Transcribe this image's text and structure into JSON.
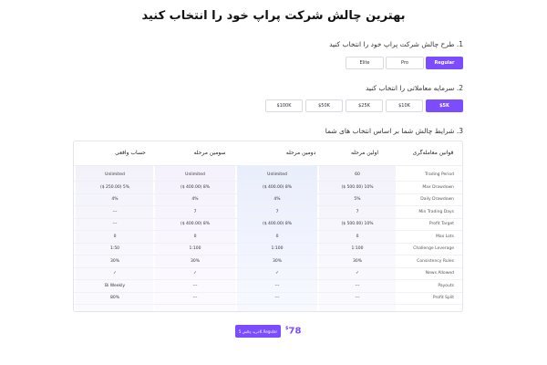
{
  "title": "بهترین چالش شرکت پراپ خود را انتخاب کنید",
  "step1": {
    "label": "1. طرح چالش شرکت پراپ خود را انتخاب کنید",
    "options": [
      "Elite",
      "Pro",
      "Regular"
    ],
    "selected": "Regular"
  },
  "step2": {
    "label": "2. سرمایه معاملاتی را انتخاب کنید",
    "options": [
      "$100K",
      "$50K",
      "$25K",
      "$10K",
      "$5K"
    ],
    "selected": "$5K"
  },
  "step3": {
    "label": "3. شرایط چالش شما بر اساس انتخاب های شما"
  },
  "table": {
    "headers": [
      "قوانین معامله‌گری",
      "اولین مرحله",
      "دومین مرحله",
      "سومین مرحله",
      "حساب واقعی"
    ],
    "rows": [
      {
        "label": "Trading Period",
        "c1": "60",
        "c2": "Unlimited",
        "c3": "Unlimited",
        "c4": "Unlimited"
      },
      {
        "label": "Max Drawdown",
        "c1": "($ 500.00) 10%",
        "c2": "($ 400.00) 8%",
        "c3": "($ 400.00) 8%",
        "c4": "($ 250.00) 5%"
      },
      {
        "label": "Daily Drawdown",
        "c1": "5%",
        "c2": "4%",
        "c3": "4%",
        "c4": "4%"
      },
      {
        "label": "Min Trading Days",
        "c1": "7",
        "c2": "7",
        "c3": "7",
        "c4": "---"
      },
      {
        "label": "Profit Target",
        "c1": "($ 500.00) 10%",
        "c2": "($ 400.00) 8%",
        "c3": "($ 400.00) 8%",
        "c4": "---"
      },
      {
        "label": "Max Lots",
        "c1": "0",
        "c2": "0",
        "c3": "0",
        "c4": "0"
      },
      {
        "label": "Challenge Leverage",
        "c1": "1:100",
        "c2": "1:100",
        "c3": "1:100",
        "c4": "1:50"
      },
      {
        "label": "Consistency Rules",
        "c1": "30%",
        "c2": "30%",
        "c3": "30%",
        "c4": "30%"
      },
      {
        "label": "News Allowed",
        "c1": "✓",
        "c2": "✓",
        "c3": "✓",
        "c4": "✓"
      },
      {
        "label": "Payouts",
        "c1": "---",
        "c2": "---",
        "c3": "---",
        "c4": "Bi Weekly"
      },
      {
        "label": "Profit Split",
        "c1": "---",
        "c2": "---",
        "c3": "---",
        "c4": "80%"
      }
    ]
  },
  "price": {
    "amount": "78",
    "currency": "$"
  },
  "buy_label": "خرید چالش 5K Regular"
}
